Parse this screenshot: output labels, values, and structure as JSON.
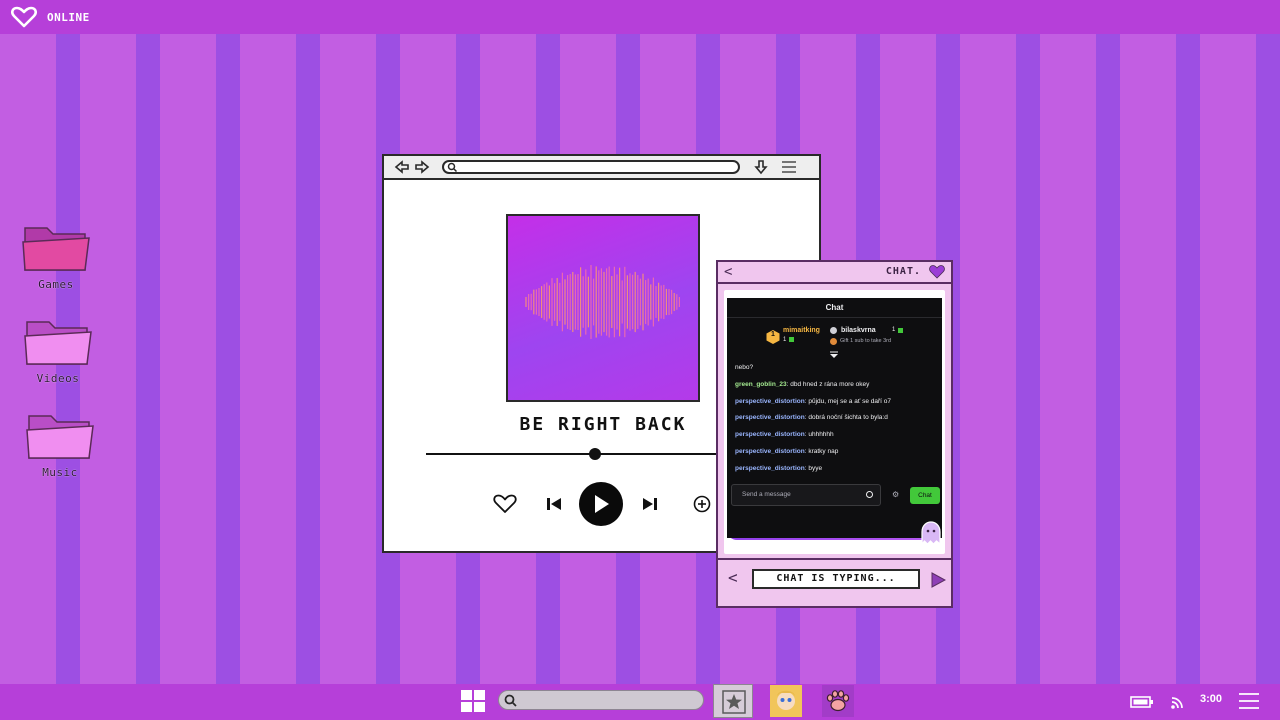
{
  "topbar": {
    "status": "ONLINE",
    "icon": "heart-outline-icon"
  },
  "desktop": {
    "icons": [
      {
        "label": "Games",
        "icon": "folder-pink-icon"
      },
      {
        "label": "Videos",
        "icon": "folder-light-pink-icon"
      },
      {
        "label": "Music",
        "icon": "folder-light-pink-icon"
      }
    ]
  },
  "player": {
    "track_title": "BE RIGHT BACK",
    "progress": 0.58,
    "icons": [
      "back-arrow-icon",
      "forward-arrow-icon",
      "search-icon",
      "download-icon",
      "menu-icon"
    ],
    "controls": [
      "heart-icon",
      "skip-back-icon",
      "play-icon",
      "skip-forward-icon",
      "add-icon"
    ]
  },
  "chat_window": {
    "title": "CHAT.",
    "back_glyph": "<",
    "typing_text": "CHAT IS TYPING...",
    "nav_left_glyph": "<",
    "twitch": {
      "header": "Chat",
      "leaderboard": [
        {
          "rank": "1",
          "name": "mimaitking",
          "count": "1"
        },
        {
          "name": "bilaskvrna",
          "count": "1",
          "note": "Gift 1 sub to take 3rd"
        }
      ],
      "messages": [
        {
          "user": "",
          "text": "nebo?"
        },
        {
          "user": "green_goblin_23",
          "text": "dbd hned z rána more okey"
        },
        {
          "user": "perspective_distortion",
          "text": "půjdu, mej se a ať se daří o7"
        },
        {
          "user": "perspective_distortion",
          "text": "dobrá noční šichta to byla:d"
        },
        {
          "user": "perspective_distortion",
          "text": "uhhhhhh"
        },
        {
          "user": "perspective_distortion",
          "text": "kratky nap"
        },
        {
          "user": "perspective_distortion",
          "text": "byye"
        }
      ],
      "input_placeholder": "Send a message",
      "chat_button": "Chat",
      "colors": {
        "user_green": "#a3e88f",
        "user_blue": "#9ab6ff",
        "chat_button": "#42c83a",
        "lead_gold": "#f5b642"
      }
    }
  },
  "taskbar": {
    "clock": "3:00",
    "icons": [
      "windows-grid-icon",
      "search-icon",
      "star-app-icon",
      "avatar-app-icon",
      "paw-app-icon",
      "battery-icon",
      "wifi-icon",
      "hamburger-menu-icon"
    ]
  },
  "colors": {
    "background_stripe_light": "#c25ee2",
    "background_stripe_dark": "#9d4fe3",
    "bar": "#b63fd9",
    "chat_panel": "#f0c6ee"
  }
}
